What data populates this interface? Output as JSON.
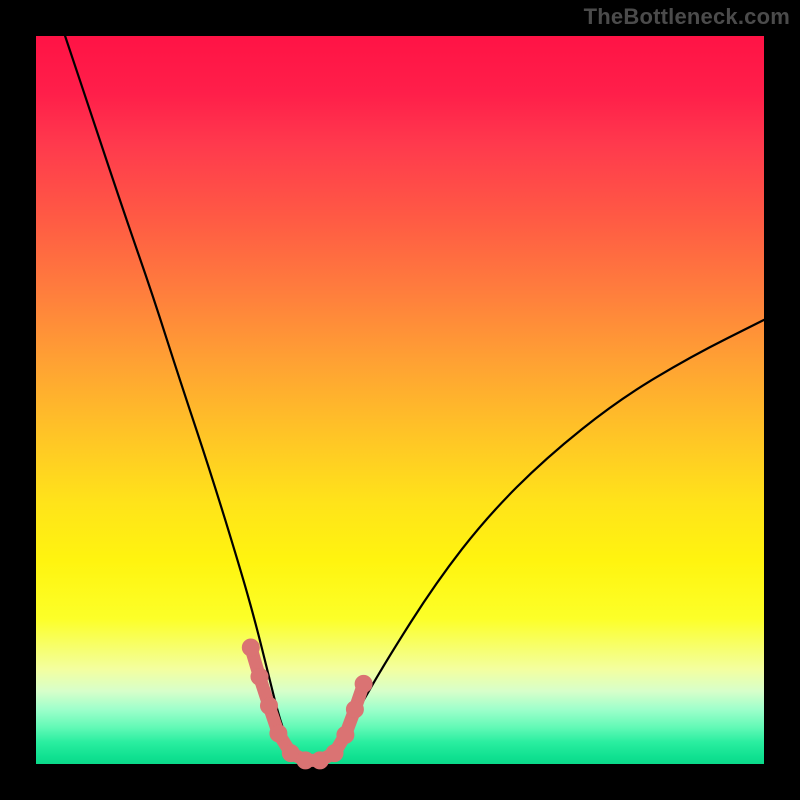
{
  "watermark": "TheBottleneck.com",
  "colors": {
    "frame": "#000000",
    "gradient_top": "#ff1345",
    "gradient_mid": "#ffe31a",
    "gradient_bottom": "#0bd98a",
    "curve": "#000000",
    "marker": "#da7373"
  },
  "chart_data": {
    "type": "line",
    "title": "",
    "xlabel": "",
    "ylabel": "",
    "xlim": [
      0,
      100
    ],
    "ylim": [
      0,
      100
    ],
    "series": [
      {
        "name": "bottleneck-curve",
        "x": [
          4,
          8,
          12,
          16,
          20,
          24,
          28,
          30,
          32,
          33.5,
          35,
          37,
          39,
          41,
          44,
          48,
          55,
          62,
          70,
          80,
          90,
          100
        ],
        "values": [
          100,
          88,
          76,
          64.5,
          52,
          40,
          27,
          20,
          12,
          6,
          2,
          0.5,
          0.5,
          2,
          7,
          14,
          25,
          34,
          42,
          50,
          56,
          61
        ]
      }
    ],
    "markers": {
      "name": "highlight-band",
      "x": [
        29.5,
        30.7,
        32,
        33.3,
        35,
        37,
        39,
        41,
        42.5,
        43.8,
        45
      ],
      "values": [
        16,
        12,
        8,
        4.2,
        1.5,
        0.5,
        0.5,
        1.5,
        4,
        7.5,
        11
      ]
    },
    "annotations": []
  }
}
